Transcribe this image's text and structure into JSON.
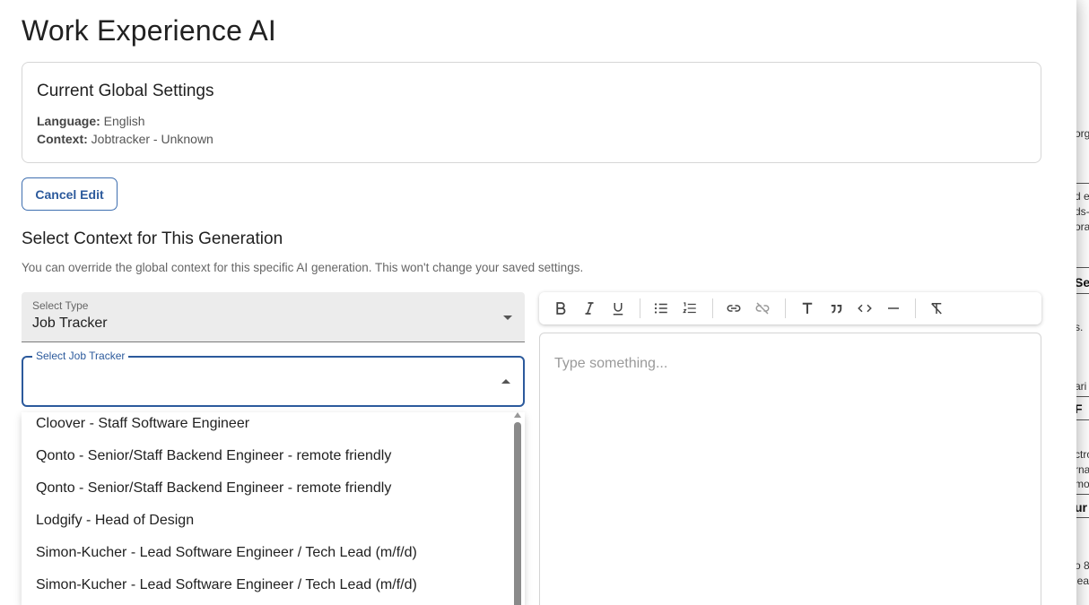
{
  "dialog": {
    "title": "Work Experience AI",
    "settings": {
      "title": "Current Global Settings",
      "language_label": "Language:",
      "language_value": "English",
      "context_label": "Context:",
      "context_value": "Jobtracker - Unknown"
    },
    "cancel_label": "Cancel Edit",
    "section_title": "Select Context for This Generation",
    "section_hint": "You can override the global context for this specific AI generation. This won't change your saved settings.",
    "select_type": {
      "label": "Select Type",
      "value": "Job Tracker"
    },
    "select_job": {
      "label": "Select Job Tracker",
      "value": ""
    },
    "job_options": [
      "Cloover - Staff Software Engineer",
      "Qonto - Senior/Staff Backend Engineer - remote friendly",
      "Qonto - Senior/Staff Backend Engineer - remote friendly",
      "Lodgify - Head of Design",
      "Simon-Kucher - Lead Software Engineer / Tech Lead (m/f/d)",
      "Simon-Kucher - Lead Software Engineer / Tech Lead (m/f/d)"
    ],
    "editor": {
      "placeholder": "Type something...",
      "toolbar_icons": [
        "bold-icon",
        "italic-icon",
        "underline-icon",
        "bullet-list-icon",
        "numbered-list-icon",
        "link-icon",
        "unlink-icon",
        "heading-icon",
        "quote-icon",
        "code-icon",
        "horizontal-rule-icon",
        "clear-format-icon"
      ]
    }
  },
  "background_fragments": [
    "org",
    "d e",
    "ds-",
    "ora",
    "Se",
    "s.",
    "ari",
    "F",
    "ctro",
    "rna",
    "mo",
    "ur",
    "o 8",
    "lea"
  ],
  "colors": {
    "accent": "#2c5a9c",
    "overlay": "#5e5e5e"
  }
}
